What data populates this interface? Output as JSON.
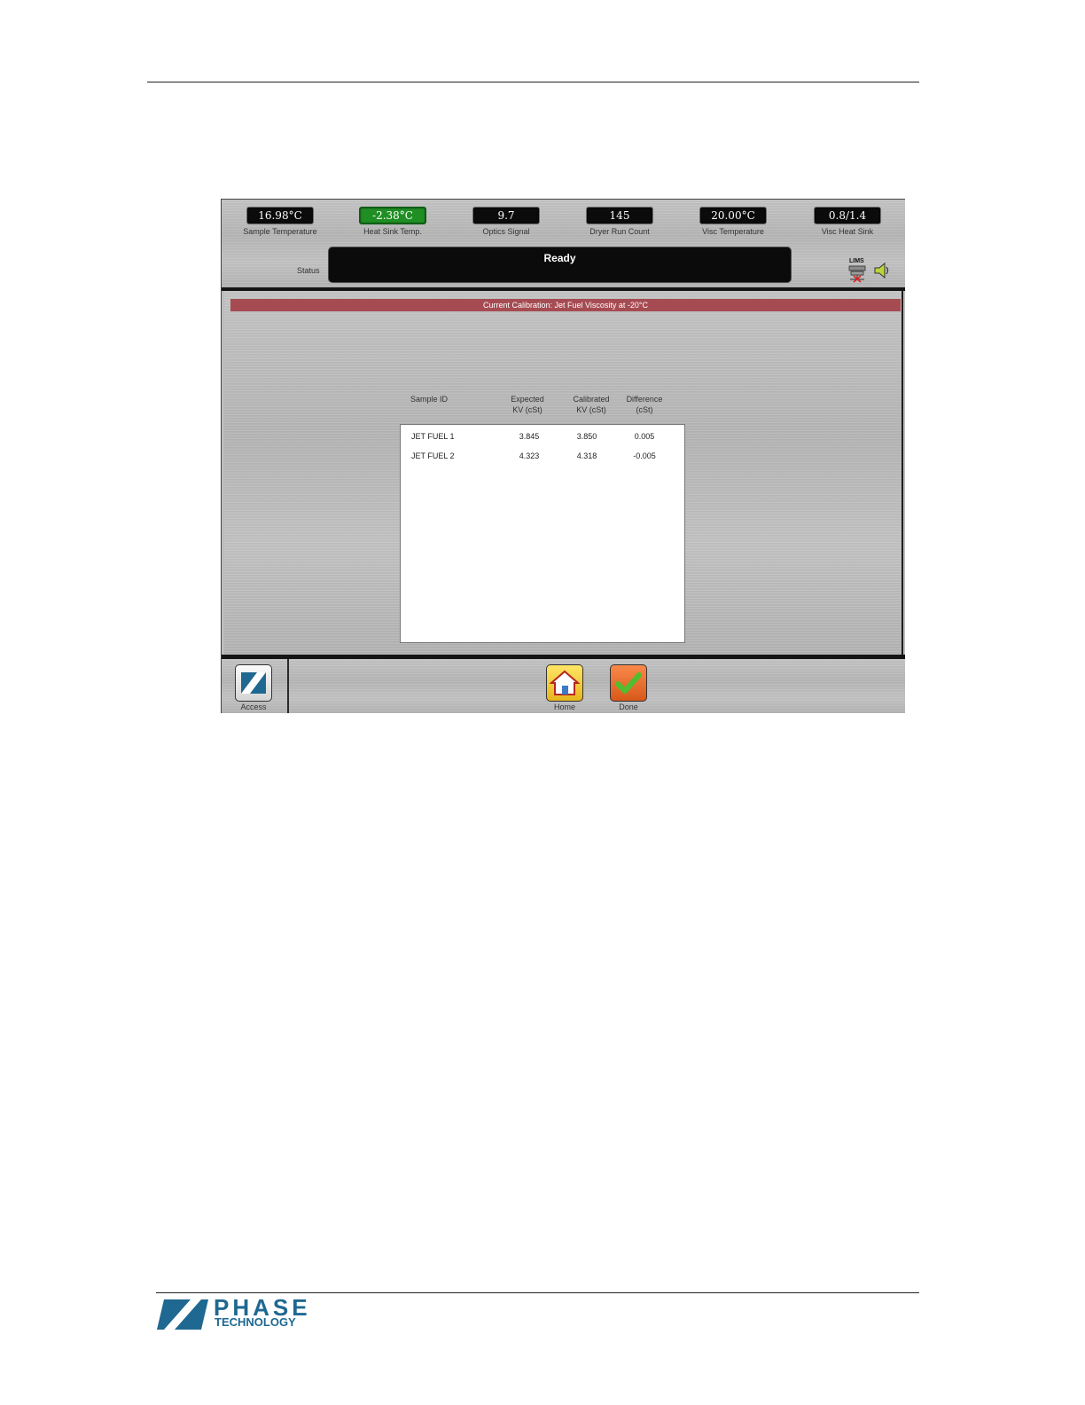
{
  "gauges": [
    {
      "value": "16.98°C",
      "label": "Sample Temperature",
      "highlight": false
    },
    {
      "value": "-2.38°C",
      "label": "Heat Sink Temp.",
      "highlight": true
    },
    {
      "value": "9.7",
      "label": "Optics Signal",
      "highlight": false
    },
    {
      "value": "145",
      "label": "Dryer Run Count",
      "highlight": false
    },
    {
      "value": "20.00°C",
      "label": "Visc Temperature",
      "highlight": false
    },
    {
      "value": "0.8/1.4",
      "label": "Visc Heat Sink",
      "highlight": false
    }
  ],
  "status": {
    "label": "Status",
    "text": "Ready"
  },
  "indicators": {
    "lims_label": "LIMS",
    "lims_icon": "lims-disconnected-icon",
    "speaker_icon": "speaker-icon"
  },
  "calibration": {
    "banner": "Current Calibration: Jet Fuel Viscosity at -20°C"
  },
  "table": {
    "headers": {
      "sample_id": "Sample ID",
      "expected_1": "Expected",
      "expected_2": "KV (cSt)",
      "calibrated_1": "Calibrated",
      "calibrated_2": "KV (cSt)",
      "difference_1": "Difference",
      "difference_2": "(cSt)"
    },
    "rows": [
      {
        "sample_id": "JET FUEL 1",
        "expected": "3.845",
        "calibrated": "3.850",
        "difference": "0.005"
      },
      {
        "sample_id": "JET FUEL 2",
        "expected": "4.323",
        "calibrated": "4.318",
        "difference": "-0.005"
      }
    ]
  },
  "footer": {
    "access_label": "Access",
    "home_label": "Home",
    "done_label": "Done"
  },
  "logo": {
    "name": "PHASE",
    "subtitle": "TECHNOLOGY",
    "color": "#1f6891"
  },
  "colors": {
    "banner": "#a64b52",
    "highlight_gauge": "#1f8f24",
    "display_bg": "#0b0b0b"
  }
}
